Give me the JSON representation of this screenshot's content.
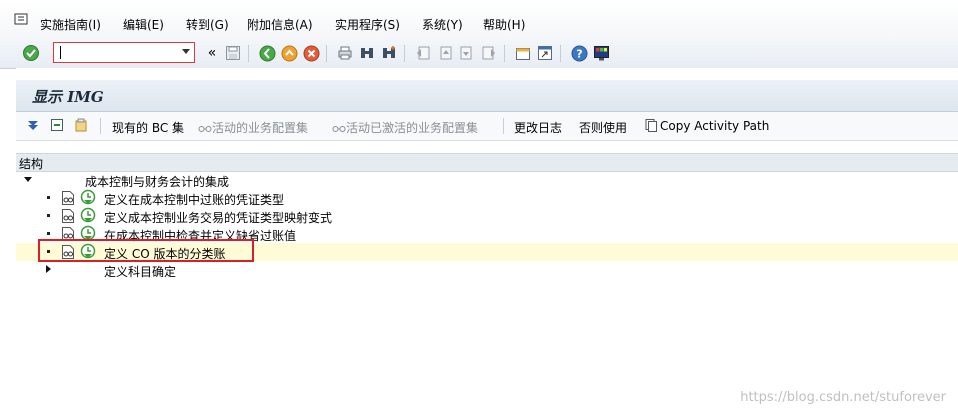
{
  "menubar": {
    "items": [
      "实施指南(I)",
      "编辑(E)",
      "转到(G)",
      "附加信息(A)",
      "实用程序(S)",
      "系统(Y)",
      "帮助(H)"
    ]
  },
  "toolbar": {
    "command_value": "",
    "nav_glyph": "«"
  },
  "page": {
    "title": "显示 IMG"
  },
  "app_toolbar": {
    "existing_bc_sets": "现有的 BC 集",
    "activated_bc_sets": "活动的业务配置集",
    "activated_activated_bc_sets": "活动已激活的业务配置集",
    "change_log": "更改日志",
    "otherwise_use": "否则使用",
    "copy_activity_path": "Copy Activity Path"
  },
  "tree": {
    "header": "结构",
    "root_label": "成本控制与财务会计的集成",
    "nodes": [
      {
        "label": "定义在成本控制中过账的凭证类型"
      },
      {
        "label": "定义成本控制业务交易的凭证类型映射变式"
      },
      {
        "label": "在成本控制中检查并定义缺省过账值"
      },
      {
        "label": "定义 CO 版本的分类账"
      },
      {
        "label": "定义科目确定"
      }
    ]
  },
  "watermark": "https://blog.csdn.net/stuforever",
  "colors": {
    "highlight_border": "#d81f2a",
    "selected_row": "#fffbd6",
    "exec_green": "#3a9a3a"
  }
}
